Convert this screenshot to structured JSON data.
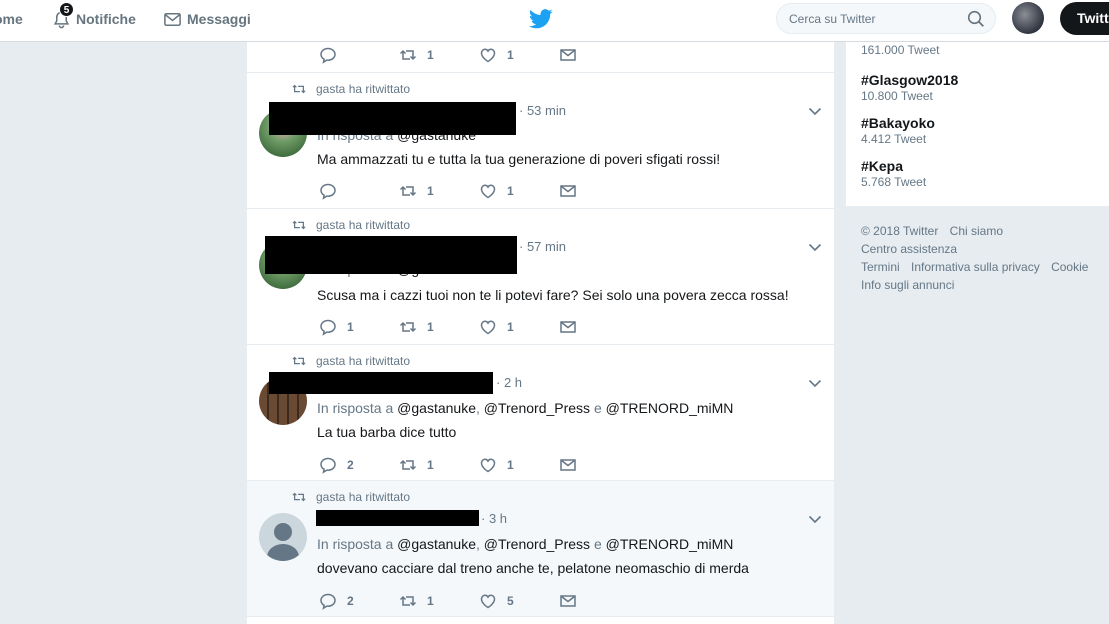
{
  "nav": {
    "home": "ome",
    "notifications": "Notifiche",
    "notification_count": "5",
    "messages": "Messaggi"
  },
  "search": {
    "placeholder": "Cerca su Twitter"
  },
  "tweet_button": "Twitt",
  "colors": {
    "accent": "#1da1f2",
    "text": "#14171a",
    "muted": "#657786",
    "background": "#e6ecf0"
  },
  "top_tweet_actions": {
    "retweets": "1",
    "likes": "1"
  },
  "tweets": [
    {
      "context": "gasta ha ritwittato",
      "time": "· 53 min",
      "reply_prefix": "In risposta a",
      "mentions": "@gastanuke",
      "text": "Ma ammazzati tu e tutta la tua generazione di poveri sfigati rossi!",
      "replies": "",
      "retweets": "1",
      "likes": "1"
    },
    {
      "context": "gasta ha ritwittato",
      "time": "· 57 min",
      "reply_prefix": "In risposta a",
      "mentions": "@gastanuke",
      "text": "Scusa ma i cazzi tuoi non te li potevi fare? Sei solo una povera zecca rossa!",
      "replies": "1",
      "retweets": "1",
      "likes": "1"
    },
    {
      "context": "gasta ha ritwittato",
      "time": "· 2 h",
      "reply_prefix": "In risposta a",
      "mention_1": "@gastanuke",
      "mention_2": "@Trenord_Press",
      "conj": "e",
      "mention_3": "@TRENORD_miMN",
      "text": "La tua barba dice tutto",
      "replies": "2",
      "retweets": "1",
      "likes": "1"
    },
    {
      "context": "gasta ha ritwittato",
      "time": "· 3 h",
      "reply_prefix": "In risposta a",
      "mention_1": "@gastanuke",
      "mention_2": "@Trenord_Press",
      "conj": "e",
      "mention_3": "@TRENORD_miMN",
      "text": "dovevano cacciare dal treno anche te, pelatone neomaschio di merda",
      "replies": "2",
      "retweets": "1",
      "likes": "5"
    }
  ],
  "trends": [
    {
      "name": "",
      "count": "161.000 Tweet"
    },
    {
      "name": "#Glasgow2018",
      "count": "10.800 Tweet"
    },
    {
      "name": "#Bakayoko",
      "count": "4.412 Tweet"
    },
    {
      "name": "#Kepa",
      "count": "5.768 Tweet"
    }
  ],
  "footer": {
    "copyright": "© 2018 Twitter",
    "about": "Chi siamo",
    "help": "Centro assistenza",
    "terms": "Termini",
    "privacy": "Informativa sulla privacy",
    "cookie": "Cookie",
    "ads": "Info sugli annunci"
  }
}
